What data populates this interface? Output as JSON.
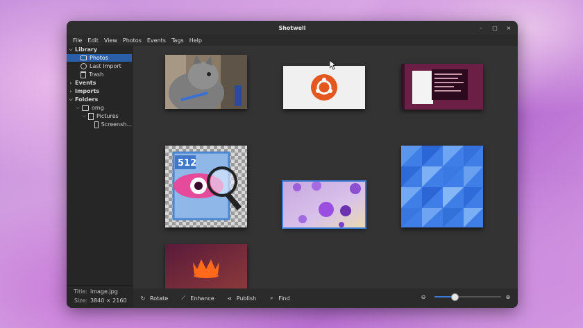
{
  "window": {
    "title": "Shotwell"
  },
  "window_controls": {
    "minimize": "–",
    "maximize": "□",
    "close": "×"
  },
  "menu": [
    "File",
    "Edit",
    "View",
    "Photos",
    "Events",
    "Tags",
    "Help"
  ],
  "sidebar": {
    "library_label": "Library",
    "photos_label": "Photos",
    "last_import_label": "Last Import",
    "trash_label": "Trash",
    "events_label": "Events",
    "imports_label": "Imports",
    "folders_label": "Folders",
    "folder_omg": "omg",
    "folder_pictures": "Pictures",
    "folder_screenshots": "Screensh..."
  },
  "info": {
    "title_key": "Title:",
    "title_value": "image.jpg",
    "size_key": "Size:",
    "size_value": "3840 × 2160"
  },
  "thumbnails": [
    {
      "id": "cat",
      "label": "cat"
    },
    {
      "id": "ubuntu-logo",
      "label": "ubuntu-logo"
    },
    {
      "id": "terminal",
      "label": "terminal"
    },
    {
      "id": "eye-icon-512",
      "label": "512"
    },
    {
      "id": "flowers",
      "label": "flowers"
    },
    {
      "id": "blue-pattern",
      "label": "blue-pattern"
    },
    {
      "id": "crown",
      "label": "crown"
    }
  ],
  "toolbar": {
    "rotate": "Rotate",
    "enhance": "Enhance",
    "publish": "Publish",
    "find": "Find",
    "zoom_level": 0.3
  },
  "icons": {
    "rotate": "rotate-icon",
    "enhance": "wand-icon",
    "publish": "share-icon",
    "find": "search-icon",
    "zoom_out": "zoom-out-icon",
    "zoom_in": "zoom-in-icon"
  },
  "colors": {
    "selection": "#2a5ea8",
    "accent": "#3d7bd6",
    "window_bg": "#2b2b2b",
    "content_bg": "#333333"
  }
}
